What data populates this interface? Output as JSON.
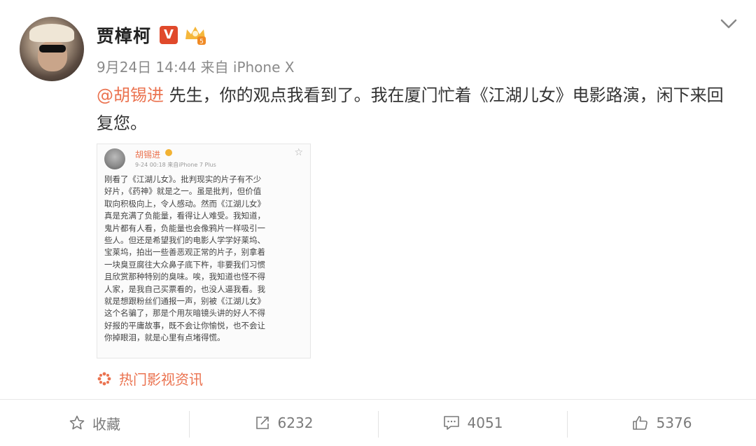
{
  "post": {
    "username": "贾樟柯",
    "verified_badge": "V",
    "meta": "9月24日 14:44 来自 iPhone X",
    "mention": "@胡锡进",
    "text": " 先生，你的观点我看到了。我在厦门忙着《江湖儿女》电影路演，闲下来回复您。",
    "source": "热门影视资讯"
  },
  "embed": {
    "name": "胡锡进",
    "meta": "9-24 00:18 来自iPhone 7 Plus",
    "lines": [
      "刚看了《江湖儿女》。批判现实的片子有不少",
      "好片，《药神》就是之一。虽是批判，但价值",
      "取向积极向上，令人感动。然而《江湖儿女》",
      "真是充满了负能量，看得让人难受。我知道，",
      "鬼片都有人看，负能量也会像鸦片一样吸引一",
      "些人。但还是希望我们的电影人学学好莱坞、",
      "宝莱坞，拍出一些善恶观正常的片子，别拿着",
      "一块臭豆腐往大众鼻子底下杵，非要我们习惯",
      "且欣赏那种特别的臭味。唉，我知道也怪不得",
      "人家，是我自己买票看的，也没人逼我看。我",
      "就是想跟粉丝们通报一声，别被《江湖儿女》",
      "这个名骗了，那是个用灰暗镜头讲的好人不得",
      "好报的平庸故事，既不会让你愉悦，也不会让",
      "你掉眼泪，就是心里有点堵得慌。"
    ]
  },
  "actions": {
    "favorite": "收藏",
    "repost": "6232",
    "comment": "4051",
    "like": "5376"
  },
  "colors": {
    "accent": "#eb7350",
    "badge": "#e0492b"
  }
}
